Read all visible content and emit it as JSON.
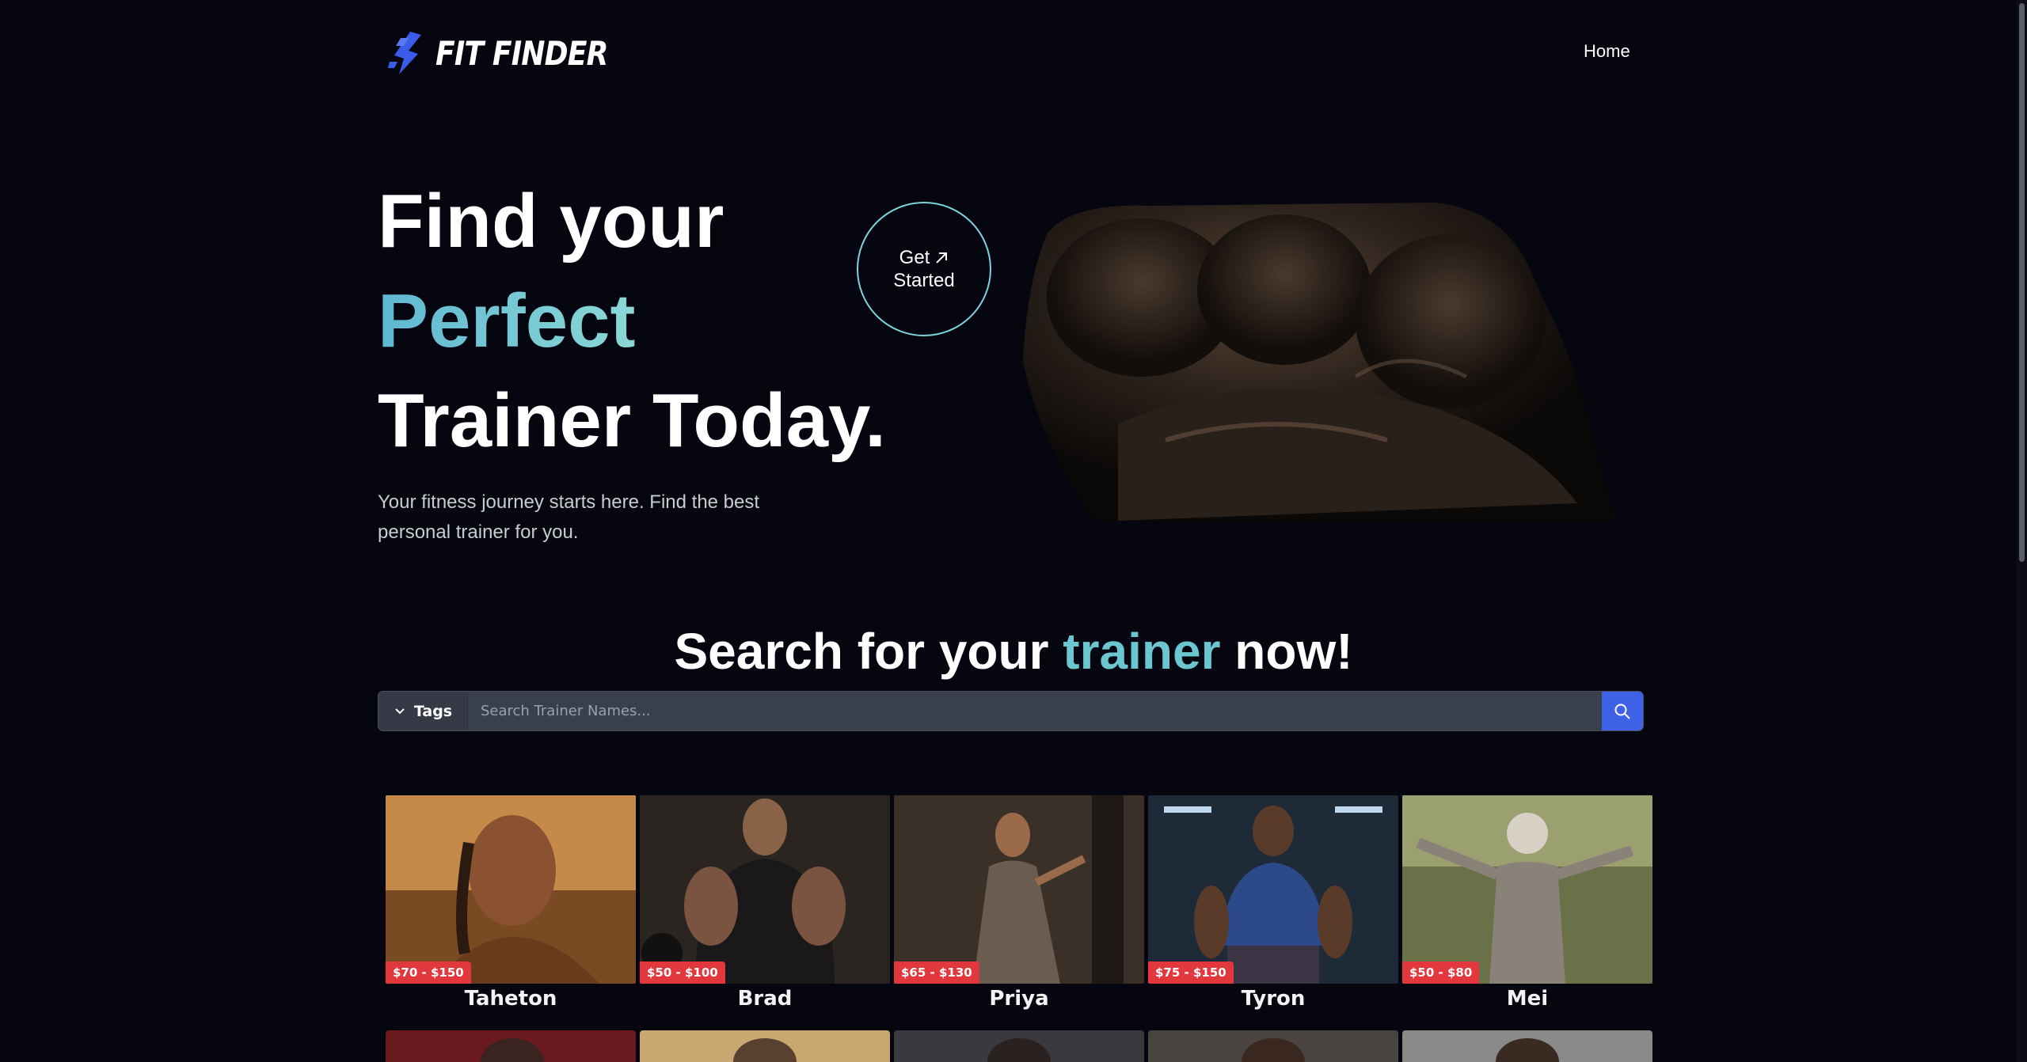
{
  "nav": {
    "logo_text": "FIT FINDER",
    "logo_icon": "runner-icon",
    "links": [
      {
        "label": "Home"
      }
    ]
  },
  "hero": {
    "line1": "Find your",
    "line2": "Perfect",
    "line3": "Trainer Today.",
    "subtitle": "Your fitness journey starts here. Find the best personal trainer for you.",
    "cta_line1": "Get",
    "cta_line2": "Started",
    "cta_icon": "arrow-up-right-icon"
  },
  "search": {
    "title_before": "Search for your",
    "title_accent": "trainer",
    "title_after": "now!",
    "tags_label": "Tags",
    "placeholder": "Search Trainer Names...",
    "button_icon": "search-icon"
  },
  "trainers": [
    {
      "name": "Taheton",
      "price": "$70 - $150"
    },
    {
      "name": "Brad",
      "price": "$50 - $100"
    },
    {
      "name": "Priya",
      "price": "$65 - $130"
    },
    {
      "name": "Tyron",
      "price": "$75 - $150"
    },
    {
      "name": "Mei",
      "price": "$50 - $80"
    }
  ],
  "colors": {
    "background": "#05060f",
    "accent": "#6cc6cf",
    "price_badge": "#e2373c",
    "search_button": "#3e61e6",
    "logo_blue": "#3b5bea"
  }
}
